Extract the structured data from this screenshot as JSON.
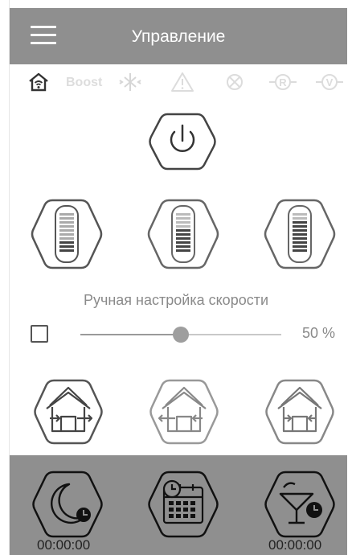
{
  "app": {
    "title": "Управление"
  },
  "modes": [
    {
      "name": "home-wifi-icon",
      "active": true
    },
    {
      "name": "boost",
      "label": "Boost"
    },
    {
      "name": "defrost-icon"
    },
    {
      "name": "warning-icon"
    },
    {
      "name": "fan-off-icon"
    },
    {
      "name": "r-mode-icon",
      "letter": "R"
    },
    {
      "name": "v-mode-icon",
      "letter": "V"
    }
  ],
  "power": {
    "icon": "power-icon"
  },
  "speeds": [
    {
      "name": "speed-1",
      "icon": "speed-bars-icon",
      "level": "low"
    },
    {
      "name": "speed-2",
      "icon": "speed-bars-icon",
      "level": "medium"
    },
    {
      "name": "speed-3",
      "icon": "speed-bars-icon",
      "level": "high"
    }
  ],
  "manual": {
    "label": "Ручная настройка скорости",
    "checked": false,
    "value": 50,
    "value_text": "50 %"
  },
  "airflow": [
    {
      "name": "airflow-out",
      "icon": "house-exhaust-icon"
    },
    {
      "name": "airflow-in",
      "icon": "house-supply-icon"
    },
    {
      "name": "airflow-recovery",
      "icon": "house-recovery-icon"
    }
  ],
  "timers": [
    {
      "name": "night-timer",
      "icon": "moon-clock-icon",
      "value": "00:00:00"
    },
    {
      "name": "schedule",
      "icon": "calendar-clock-icon",
      "value": ""
    },
    {
      "name": "party-timer",
      "icon": "cocktail-clock-icon",
      "value": "00:00:00"
    }
  ],
  "colors": {
    "bar": "#8f8f8f",
    "icon_dark": "#555555",
    "icon_light": "#b5b5b5",
    "disabled": "#dddddd"
  }
}
